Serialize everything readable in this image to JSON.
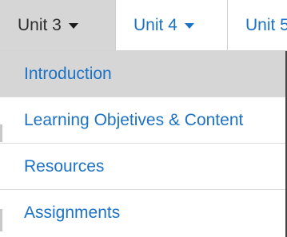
{
  "tabs": [
    {
      "label": "Unit 3",
      "has_caret": true,
      "state": "active"
    },
    {
      "label": "Unit 4",
      "has_caret": true,
      "state": "inactive"
    },
    {
      "label": "Unit 5",
      "has_caret": false,
      "state": "inactive"
    }
  ],
  "menu": {
    "items": [
      {
        "label": "Introduction",
        "state": "hovered"
      },
      {
        "label": "Learning Objetives & Content",
        "state": "normal"
      },
      {
        "label": "Resources",
        "state": "normal"
      },
      {
        "label": "Assignments",
        "state": "normal"
      }
    ]
  },
  "colors": {
    "link": "#1c72c4",
    "active_tab_bg": "#d6d6d6",
    "hover_item_bg": "#d6d6d6",
    "active_tab_text": "#2e2e2e"
  },
  "icons": {
    "caret": "caret-down-icon"
  }
}
